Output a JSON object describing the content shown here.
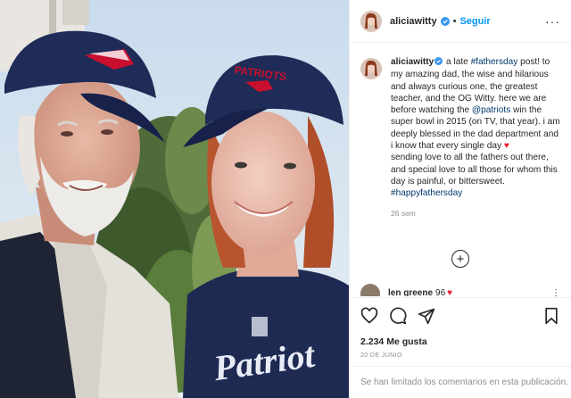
{
  "post": {
    "username": "aliciawitty",
    "follow_label": "Seguir",
    "more_icon": "more-icon"
  },
  "caption": {
    "username": "aliciawitty",
    "part1": " a late ",
    "tag_fathersday": "#fathersday",
    "part2": " post! to my amazing dad, the wise and hilarious and always curious one, the greatest teacher, and the OG Witty. here we are before watching the ",
    "mention_patriots": "@patriots",
    "part3": " win the super bowl in 2015 (on TV, that year). i am deeply blessed in the dad department and i know that every single day ",
    "part4": "sending love to all the fathers out there, and special love to all those for whom this day is painful, or bittersweet.",
    "tag_happyfathersday": "#happyfathersday",
    "heart": "♥",
    "time": "26 sem"
  },
  "load_more_icon": "+",
  "comment": {
    "username": "len greene",
    "text": "96",
    "heart": "♥",
    "more": "⋮"
  },
  "actions": {
    "like_icon": "heart-outline-icon",
    "comment_icon": "comment-bubble-icon",
    "share_icon": "paper-plane-icon",
    "save_icon": "bookmark-icon"
  },
  "likes": "2.234 Me gusta",
  "date": "20 DE JUNIO",
  "footer": "Se han limitado los comentarios en esta publicación.",
  "colors": {
    "follow_blue": "#0095f6",
    "link_blue": "#00376b",
    "heart_red": "#ed1b2e",
    "muted": "#8e8e8e",
    "cap_navy": "#1d2a52"
  }
}
